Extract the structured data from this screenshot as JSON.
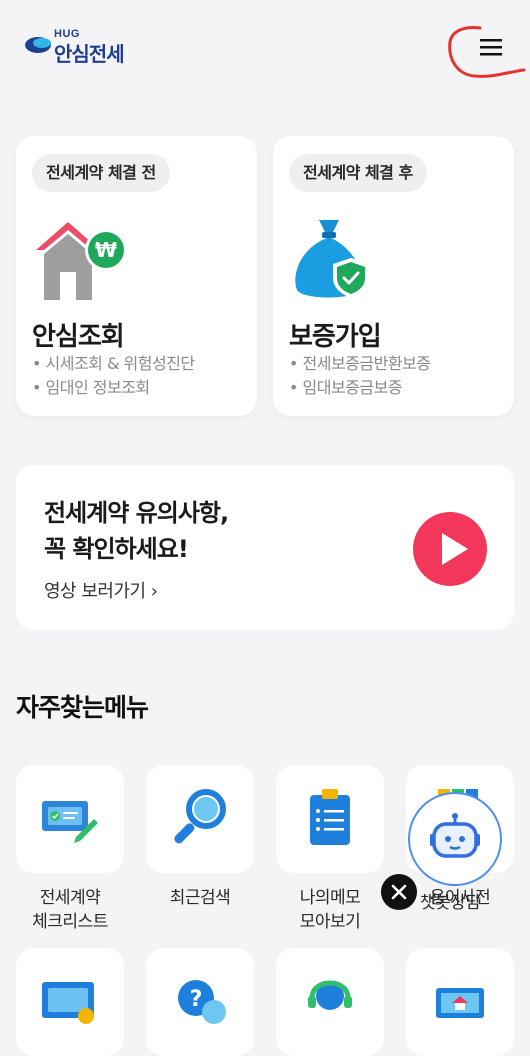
{
  "header": {
    "logo_small": "HUG",
    "logo_text": "안심전세",
    "menu_icon": "hamburger-icon"
  },
  "cards": [
    {
      "chip": "전세계약 체결 전",
      "title": "안심조회",
      "bullets": [
        "• 시세조회 & 위험성진단",
        "• 임대인 정보조회"
      ],
      "icon": "house-won-icon"
    },
    {
      "chip": "전세계약 체결 후",
      "title": "보증가입",
      "bullets": [
        "• 전세보증금반환보증",
        "• 임대보증금보증"
      ],
      "icon": "money-bag-shield-icon"
    }
  ],
  "banner": {
    "title_line1": "전세계약 유의사항,",
    "title_line2": "꼭 확인하세요!",
    "link": "영상 보러가기 ›",
    "icon": "play-icon"
  },
  "frequent_menu": {
    "title": "자주찾는메뉴",
    "items": [
      {
        "line1": "전세계약",
        "line2": "체크리스트",
        "icon": "checklist-icon"
      },
      {
        "line1": "최근검색",
        "line2": "",
        "icon": "magnifier-icon"
      },
      {
        "line1": "나의메모",
        "line2": "모아보기",
        "icon": "clipboard-icon"
      },
      {
        "line1": "용어사전",
        "line2": "",
        "icon": "book-icon"
      }
    ]
  },
  "chatbot": {
    "label": "챗봇상담",
    "icon": "robot-icon",
    "close_icon": "close-icon"
  },
  "colors": {
    "brand_blue": "#1d3f8f",
    "accent_red": "#f2375a",
    "icon_blue": "#1f7fdc",
    "annotation_red": "#e8322e"
  }
}
